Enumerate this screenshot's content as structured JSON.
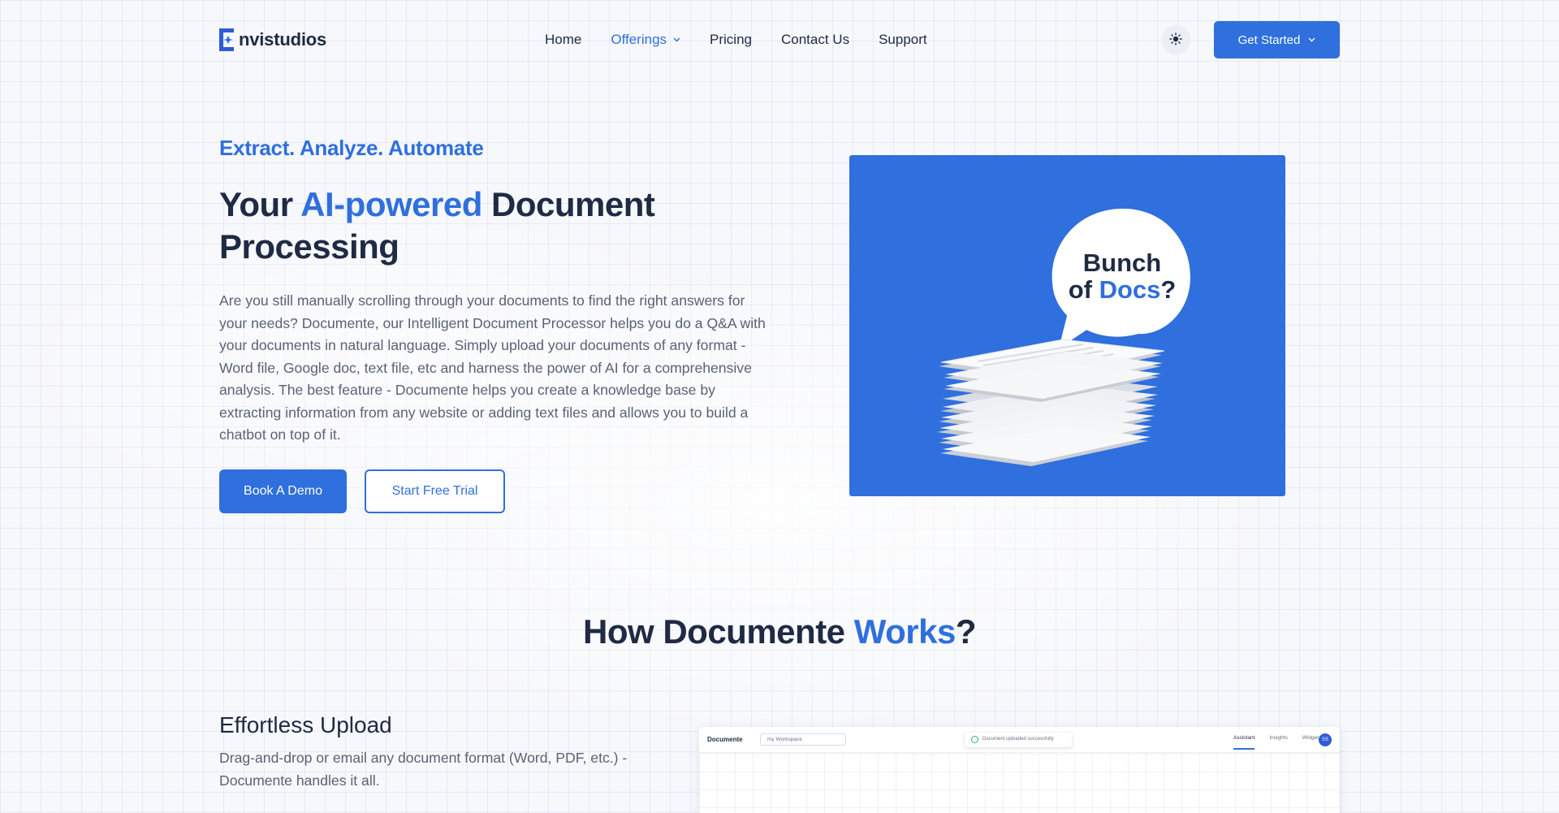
{
  "brand": {
    "logo_text": "nvistudios",
    "accent_color": "#2f6fde",
    "dark_text_color": "#1f2a44"
  },
  "nav": {
    "items": [
      {
        "label": "Home",
        "active": false
      },
      {
        "label": "Offerings",
        "active": true,
        "has_dropdown": true
      },
      {
        "label": "Pricing",
        "active": false
      },
      {
        "label": "Contact Us",
        "active": false
      },
      {
        "label": "Support",
        "active": false
      }
    ],
    "theme_toggle_icon": "sun-icon",
    "cta_label": "Get Started"
  },
  "hero": {
    "eyebrow": "Extract. Analyze. Automate",
    "title_pre": "Your ",
    "title_accent": "AI-powered",
    "title_post": " Document Processing",
    "description": "Are you still manually scrolling through your documents to find the right answers for your needs? Documente, our Intelligent Document Processor helps you do a Q&A with your documents in natural language. Simply upload your documents of any format - Word file, Google doc, text file, etc and harness the power of AI for a comprehensive analysis. The best feature - Documente helps you create a knowledge base by extracting information from any website or adding text files and allows you to build a chatbot on top of it.",
    "primary_button": "Book A Demo",
    "secondary_button": "Start Free Trial",
    "illustration": {
      "bubble_line1": "Bunch",
      "bubble_line2_pre": "of ",
      "bubble_line2_accent": "Docs",
      "bubble_line2_post": "?",
      "background_color": "#2f6fde"
    }
  },
  "how_it_works": {
    "title_pre": "How Documente ",
    "title_accent": "Works",
    "title_post": "?",
    "feature": {
      "title": "Effortless Upload",
      "description": "Drag-and-drop or email any document format (Word, PDF, etc.) - Documente handles it all."
    },
    "preview": {
      "app_name": "Documente",
      "workspace": "my Workspace",
      "toast": "Document uploaded successfully",
      "tabs": [
        "Assistant",
        "Insights",
        "Widget"
      ],
      "avatar_initials": "SS"
    }
  }
}
